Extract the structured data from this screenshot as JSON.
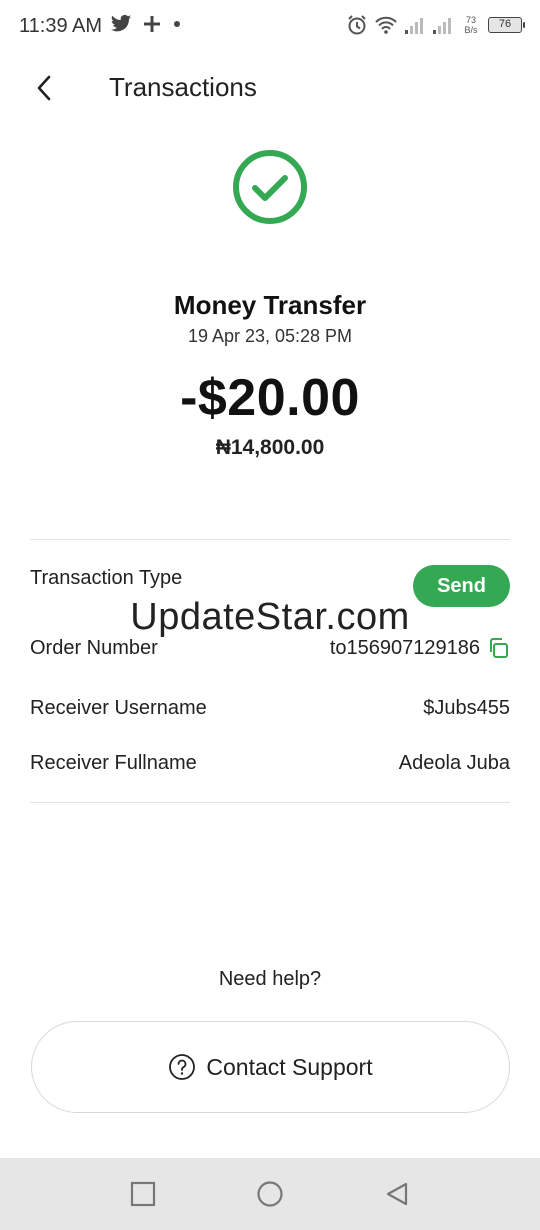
{
  "status_bar": {
    "time": "11:39 AM",
    "net_speed_value": "73",
    "net_speed_unit": "B/s",
    "battery_level": "76"
  },
  "header": {
    "title": "Transactions"
  },
  "transaction": {
    "title": "Money Transfer",
    "datetime": "19 Apr 23, 05:28 PM",
    "amount": "-$20.00",
    "local_amount": "₦14,800.00"
  },
  "details": {
    "type_label": "Transaction Type",
    "type_value": "Send",
    "order_label": "Order Number",
    "order_value": "to156907129186",
    "receiver_username_label": "Receiver Username",
    "receiver_username_value": "$Jubs455",
    "receiver_fullname_label": "Receiver Fullname",
    "receiver_fullname_value": "Adeola Juba"
  },
  "watermark": "UpdateStar.com",
  "help": {
    "prompt": "Need help?",
    "button_label": "Contact Support"
  },
  "icons": {
    "success": "check-circle-icon",
    "copy": "copy-icon",
    "support": "question-circle-icon"
  },
  "colors": {
    "accent_green": "#34a853"
  }
}
